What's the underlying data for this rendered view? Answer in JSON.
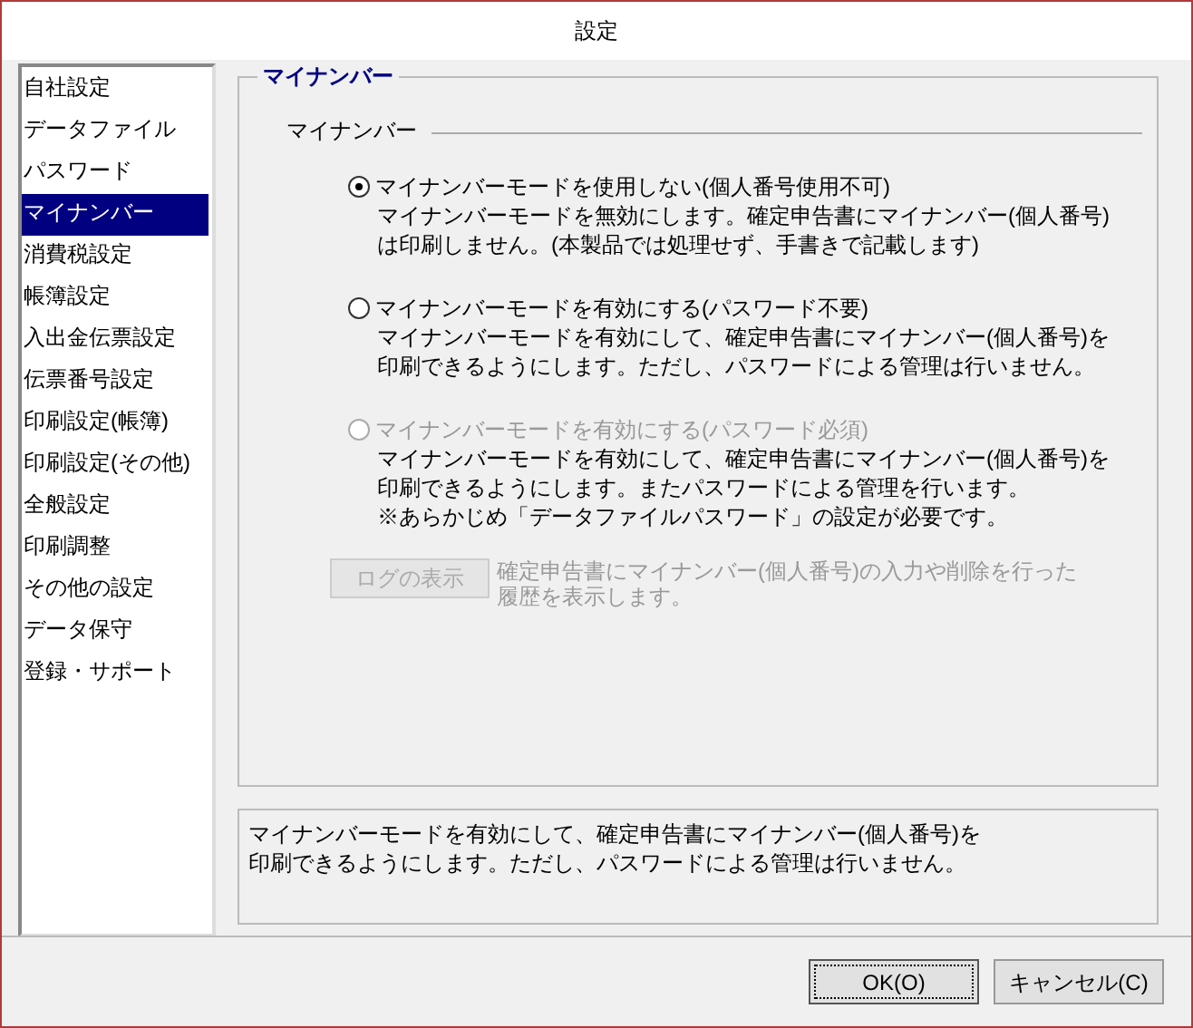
{
  "window": {
    "title": "設定"
  },
  "sidebar": {
    "items": [
      {
        "label": "自社設定",
        "selected": false
      },
      {
        "label": "データファイル",
        "selected": false
      },
      {
        "label": "パスワード",
        "selected": false
      },
      {
        "label": "マイナンバー",
        "selected": true
      },
      {
        "label": "消費税設定",
        "selected": false
      },
      {
        "label": "帳簿設定",
        "selected": false
      },
      {
        "label": "入出金伝票設定",
        "selected": false
      },
      {
        "label": "伝票番号設定",
        "selected": false
      },
      {
        "label": "印刷設定(帳簿)",
        "selected": false
      },
      {
        "label": "印刷設定(その他)",
        "selected": false
      },
      {
        "label": "全般設定",
        "selected": false
      },
      {
        "label": "印刷調整",
        "selected": false
      },
      {
        "label": "その他の設定",
        "selected": false
      },
      {
        "label": "データ保守",
        "selected": false
      },
      {
        "label": "登録・サポート",
        "selected": false
      }
    ]
  },
  "panel": {
    "title": "マイナンバー",
    "section": "マイナンバー",
    "options": [
      {
        "label": "マイナンバーモードを使用しない(個人番号使用不可)",
        "selected": true,
        "disabled": false,
        "description": [
          "マイナンバーモードを無効にします。確定申告書にマイナンバー(個人番号)",
          "は印刷しません。(本製品では処理せず、手書きで記載します)"
        ]
      },
      {
        "label": "マイナンバーモードを有効にする(パスワード不要)",
        "selected": false,
        "disabled": false,
        "description": [
          "マイナンバーモードを有効にして、確定申告書にマイナンバー(個人番号)を",
          "印刷できるようにします。ただし、パスワードによる管理は行いません。"
        ]
      },
      {
        "label": "マイナンバーモードを有効にする(パスワード必須)",
        "selected": false,
        "disabled": true,
        "description": [
          "マイナンバーモードを有効にして、確定申告書にマイナンバー(個人番号)を",
          "印刷できるようにします。またパスワードによる管理を行います。",
          "※あらかじめ「データファイルパスワード」の設定が必要です。"
        ]
      }
    ],
    "log_button": {
      "label": "ログの表示",
      "disabled": true,
      "description": [
        "確定申告書にマイナンバー(個人番号)の入力や削除を行った",
        "履歴を表示します。"
      ]
    }
  },
  "help_text": [
    "マイナンバーモードを有効にして、確定申告書にマイナンバー(個人番号)を",
    "印刷できるようにします。ただし、パスワードによる管理は行いません。"
  ],
  "buttons": [
    {
      "label": "OK(O)",
      "kind": "default"
    },
    {
      "label": "キャンセル(C)",
      "kind": "normal"
    }
  ]
}
